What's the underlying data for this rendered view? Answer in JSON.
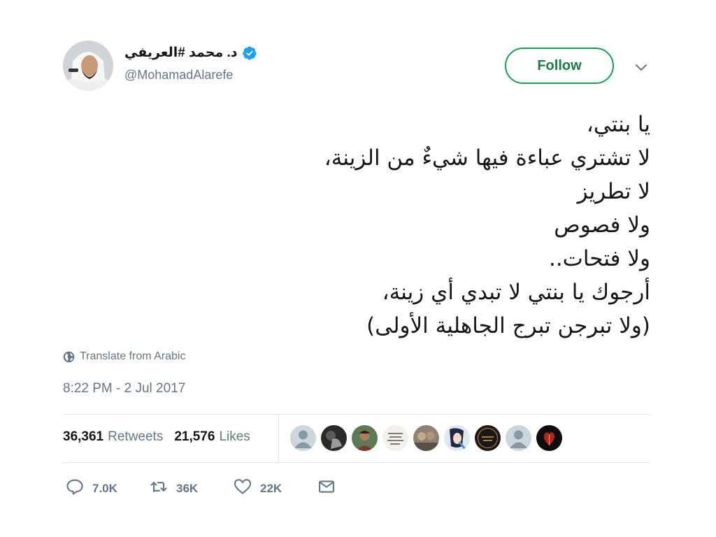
{
  "author": {
    "display_name": "د. محمد #العريفي",
    "handle": "@MohamadAlarefe",
    "verified": true,
    "avatar_icon": "person-avatar"
  },
  "follow_button": {
    "label": "Follow",
    "color": "#1a9e52"
  },
  "tweet": {
    "lines": [
      "يا بنتي،",
      "لا تشتري عباءة فيها شيءٌ من الزينة،",
      "لا تطريز",
      "ولا فصوص",
      "ولا فتحات..",
      "أرجوك يا بنتي لا تبدي أي زينة،",
      "(ولا تبرجن تبرج الجاهلية الأولى)"
    ]
  },
  "translate": {
    "label": "Translate from Arabic",
    "icon": "globe-icon"
  },
  "timestamp": "8:22 PM - 2 Jul 2017",
  "stats": {
    "retweets_count": "36,361",
    "retweets_label": "Retweets",
    "likes_count": "21,576",
    "likes_label": "Likes"
  },
  "liked_by": [
    {
      "avatar": "default-avatar"
    },
    {
      "avatar": "photo-avatar-dark"
    },
    {
      "avatar": "photo-avatar-person"
    },
    {
      "avatar": "calligraphy-avatar"
    },
    {
      "avatar": "photo-avatar-group"
    },
    {
      "avatar": "photo-avatar-anime"
    },
    {
      "avatar": "dark-text-avatar"
    },
    {
      "avatar": "default-avatar"
    },
    {
      "avatar": "photo-avatar-red"
    }
  ],
  "actions": {
    "reply_count": "7.0K",
    "retweet_count": "36K",
    "like_count": "22K"
  },
  "colors": {
    "text_primary": "#14171a",
    "text_secondary": "#657786",
    "verified_blue": "#1da1f2",
    "border": "#e1e8ed"
  }
}
